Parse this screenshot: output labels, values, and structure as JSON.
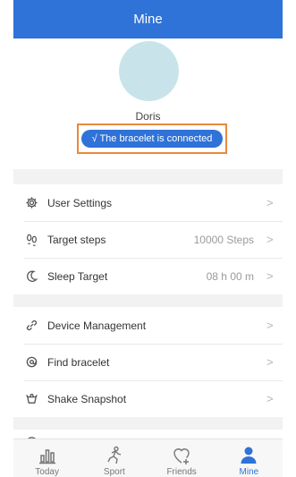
{
  "header": {
    "title": "Mine"
  },
  "profile": {
    "name": "Doris",
    "status": "√ The bracelet is connected"
  },
  "settings": [
    {
      "icon": "gear-icon",
      "label": "User Settings",
      "value": ""
    },
    {
      "icon": "footprints-icon",
      "label": "Target steps",
      "value": "10000 Steps"
    },
    {
      "icon": "moon-icon",
      "label": "Sleep Target",
      "value": "08 h 00 m"
    }
  ],
  "device": [
    {
      "icon": "link-icon",
      "label": "Device Management",
      "value": ""
    },
    {
      "icon": "locate-icon",
      "label": "Find bracelet",
      "value": ""
    },
    {
      "icon": "camera-shake-icon",
      "label": "Shake Snapshot",
      "value": ""
    }
  ],
  "tabs": [
    {
      "label": "Today",
      "icon": "bar-chart-icon",
      "active": false
    },
    {
      "label": "Sport",
      "icon": "runner-icon",
      "active": false
    },
    {
      "label": "Friends",
      "icon": "heart-plus-icon",
      "active": false
    },
    {
      "label": "Mine",
      "icon": "person-icon",
      "active": true
    }
  ],
  "colors": {
    "primary": "#2f72d8",
    "highlight": "#e98a3b",
    "avatar": "#c8e4ea",
    "divider": "#f2f2f2"
  }
}
